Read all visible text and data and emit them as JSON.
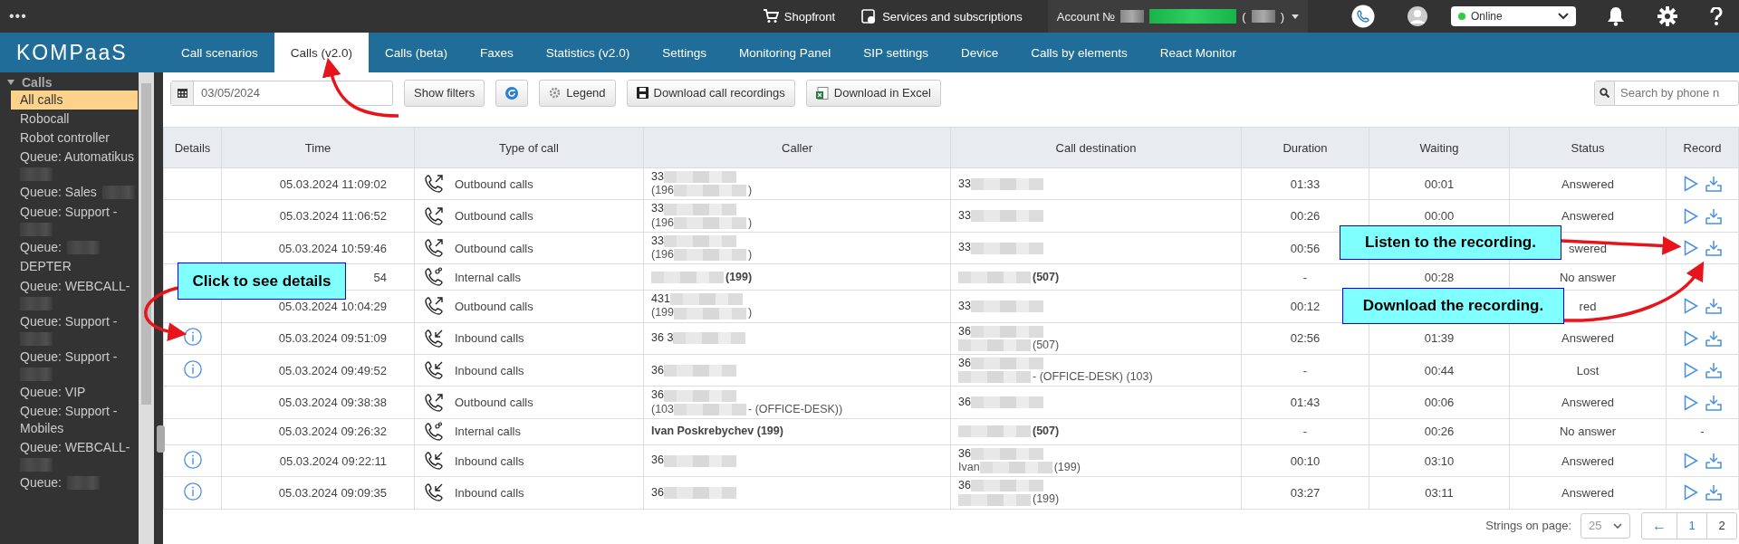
{
  "top_bar": {
    "menu": "•••",
    "links": [
      {
        "kind": "cart",
        "label": "Shopfront"
      },
      {
        "kind": "services",
        "label": "Services and subscriptions"
      }
    ],
    "account": {
      "label": "Account №",
      "open": "(",
      "close": ")"
    },
    "presence": {
      "value": "Online",
      "color": "#2ecc40"
    }
  },
  "nav": {
    "logo": "KOMPaaS",
    "tabs": [
      {
        "label": "Call scenarios",
        "selected": false
      },
      {
        "label": "Calls (v2.0)",
        "selected": true
      },
      {
        "label": "Calls (beta)",
        "selected": false
      },
      {
        "label": "Faxes",
        "selected": false
      },
      {
        "label": "Statistics (v2.0)",
        "selected": false
      },
      {
        "label": "Settings",
        "selected": false
      },
      {
        "label": "Monitoring Panel",
        "selected": false
      },
      {
        "label": "SIP settings",
        "selected": false
      },
      {
        "label": "Device",
        "selected": false
      },
      {
        "label": "Calls by elements",
        "selected": false
      },
      {
        "label": "React Monitor",
        "selected": false
      }
    ]
  },
  "sidebar": {
    "group": {
      "label": "Calls",
      "expanded": true
    },
    "items": [
      {
        "label": "All calls",
        "selected": true
      },
      {
        "label": "Robocall",
        "selected": false
      },
      {
        "label": "Robot controller",
        "selected": false
      },
      {
        "label": "Queue: Automatikus",
        "blur": true,
        "selected": false
      },
      {
        "label": "Queue: Sales",
        "blur": true,
        "selected": false
      },
      {
        "label": "Queue: Support -",
        "blur": true,
        "selected": false
      },
      {
        "label": "Queue:",
        "blur": true,
        "after": "DEPTER",
        "selected": false
      },
      {
        "label": "Queue: WEBCALL-",
        "blur": true,
        "selected": false
      },
      {
        "label": "Queue: Support -",
        "blur": true,
        "selected": false
      },
      {
        "label": "Queue: Support -",
        "blur": true,
        "selected": false
      },
      {
        "label": "Queue: VIP",
        "selected": false
      },
      {
        "label": "Queue: Support - Mobiles",
        "selected": false
      },
      {
        "label": "Queue: WEBCALL-",
        "blur": true,
        "selected": false
      },
      {
        "label": "Queue:",
        "blur": true,
        "selected": false
      }
    ]
  },
  "toolbar": {
    "date": "03/05/2024",
    "buttons": [
      {
        "kind": "text",
        "label": "Show filters"
      },
      {
        "kind": "refresh"
      },
      {
        "kind": "legend",
        "label": "Legend"
      },
      {
        "kind": "save",
        "label": "Download call recordings"
      },
      {
        "kind": "excel",
        "label": "Download in Excel"
      }
    ],
    "search_placeholder": "Search by phone n"
  },
  "table": {
    "columns": [
      "Details",
      "Time",
      "Type of call",
      "Caller",
      "Call destination",
      "Duration",
      "Waiting",
      "Status",
      "Record"
    ],
    "rows": [
      {
        "info": false,
        "time": "05.03.2024 11:09:02",
        "type": {
          "kind": "outbound",
          "label": "Outbound calls"
        },
        "caller": {
          "bold": false,
          "lines": [
            {
              "pre": "33",
              "blur": true
            },
            {
              "pre": "(196",
              "blur": true,
              "post": ")"
            }
          ]
        },
        "destination": {
          "bold": false,
          "lines": [
            {
              "pre": "33",
              "blur": true
            }
          ]
        },
        "duration": "01:33",
        "waiting": "00:01",
        "status": "Answered",
        "record": {
          "kind": "player"
        }
      },
      {
        "info": false,
        "time": "05.03.2024 11:06:52",
        "type": {
          "kind": "outbound",
          "label": "Outbound calls"
        },
        "caller": {
          "bold": false,
          "lines": [
            {
              "pre": "33",
              "blur": true
            },
            {
              "pre": "(196",
              "blur": true,
              "post": ")"
            }
          ]
        },
        "destination": {
          "bold": false,
          "lines": [
            {
              "pre": "33",
              "blur": true
            }
          ]
        },
        "duration": "00:26",
        "waiting": "00:00",
        "status": "Answered",
        "record": {
          "kind": "player"
        }
      },
      {
        "info": false,
        "time": "05.03.2024 10:59:46",
        "type": {
          "kind": "outbound",
          "label": "Outbound calls"
        },
        "caller": {
          "bold": false,
          "lines": [
            {
              "pre": "33",
              "blur": true
            },
            {
              "pre": "(196",
              "blur": true,
              "post": ")"
            }
          ]
        },
        "destination": {
          "bold": false,
          "lines": [
            {
              "pre": "33",
              "blur": true
            }
          ]
        },
        "duration": "00:56",
        "status": "swered",
        "record": {
          "kind": "player"
        }
      },
      {
        "info": false,
        "time": "54",
        "type": {
          "kind": "internal",
          "label": "Internal calls"
        },
        "caller": {
          "bold": true,
          "lines": [
            {
              "blur": true,
              "post": "(199)"
            }
          ]
        },
        "destination": {
          "bold": true,
          "lines": [
            {
              "blur": true,
              "post": "(507)"
            }
          ]
        },
        "duration": "-",
        "waiting": "00:28",
        "status": "No answer"
      },
      {
        "info": false,
        "time": "05.03.2024 10:04:29",
        "type": {
          "kind": "outbound",
          "label": "Outbound calls"
        },
        "caller": {
          "bold": false,
          "lines": [
            {
              "pre": "431",
              "blur": true
            },
            {
              "pre": "(199",
              "blur": true,
              "post": ")"
            }
          ]
        },
        "destination": {
          "bold": false,
          "lines": [
            {
              "pre": "33",
              "blur": true
            }
          ]
        },
        "duration": "00:12",
        "status": "red",
        "record": {
          "kind": "player"
        }
      },
      {
        "info": true,
        "time": "05.03.2024 09:51:09",
        "type": {
          "kind": "inbound",
          "label": "Inbound calls"
        },
        "caller": {
          "bold": false,
          "lines": [
            {
              "pre": "36 3",
              "blur": true
            }
          ]
        },
        "destination": {
          "bold": false,
          "lines": [
            {
              "pre": "36",
              "blur": true
            },
            {
              "blur": true,
              "post": "(507)"
            }
          ]
        },
        "duration": "02:56",
        "waiting": "01:39",
        "status": "Answered",
        "record": {
          "kind": "player"
        }
      },
      {
        "info": true,
        "time": "05.03.2024 09:49:52",
        "type": {
          "kind": "inbound",
          "label": "Inbound calls"
        },
        "caller": {
          "bold": false,
          "lines": [
            {
              "pre": "36",
              "blur": true
            }
          ]
        },
        "destination": {
          "bold": false,
          "lines": [
            {
              "pre": "36",
              "blur": true
            },
            {
              "blur": true,
              "post": "- (OFFICE-DESK) (103)"
            }
          ]
        },
        "duration": "-",
        "waiting": "00:44",
        "status": "Lost",
        "record": {
          "kind": "player"
        }
      },
      {
        "info": false,
        "time": "05.03.2024 09:38:38",
        "type": {
          "kind": "outbound",
          "label": "Outbound calls"
        },
        "caller": {
          "bold": false,
          "lines": [
            {
              "pre": "36",
              "blur": true
            },
            {
              "pre": "(103",
              "blur": true,
              "post": "- (OFFICE-DESK))"
            }
          ]
        },
        "destination": {
          "bold": false,
          "lines": [
            {
              "pre": "36",
              "blur": true
            }
          ]
        },
        "duration": "01:43",
        "waiting": "00:06",
        "status": "Answered",
        "record": {
          "kind": "player"
        }
      },
      {
        "info": false,
        "time": "05.03.2024 09:26:32",
        "type": {
          "kind": "internal",
          "label": "Internal calls"
        },
        "caller": {
          "bold": true,
          "lines": [
            {
              "post": "Ivan Poskrebychev (199)"
            }
          ]
        },
        "destination": {
          "bold": true,
          "lines": [
            {
              "blur": true,
              "post": "(507)"
            }
          ]
        },
        "duration": "-",
        "waiting": "00:26",
        "status": "No answer",
        "record": {
          "kind": "text",
          "text": "-"
        }
      },
      {
        "info": true,
        "time": "05.03.2024 09:22:11",
        "type": {
          "kind": "inbound",
          "label": "Inbound calls"
        },
        "caller": {
          "bold": false,
          "lines": [
            {
              "pre": "36",
              "blur": true
            }
          ]
        },
        "destination": {
          "bold": false,
          "lines": [
            {
              "pre": "36",
              "blur": true
            },
            {
              "pre": "Ivan",
              "blur": true,
              "post": "(199)"
            }
          ]
        },
        "duration": "00:10",
        "waiting": "03:10",
        "status": "Answered",
        "record": {
          "kind": "player"
        }
      },
      {
        "info": true,
        "time": "05.03.2024 09:09:35",
        "type": {
          "kind": "inbound",
          "label": "Inbound calls"
        },
        "caller": {
          "bold": false,
          "lines": [
            {
              "pre": "36",
              "blur": true
            }
          ]
        },
        "destination": {
          "bold": false,
          "lines": [
            {
              "pre": "36",
              "blur": true
            },
            {
              "blur": true,
              "post": "(199)"
            }
          ]
        },
        "duration": "03:27",
        "waiting": "03:11",
        "status": "Answered",
        "record": {
          "kind": "player"
        }
      }
    ]
  },
  "pagination": {
    "label": "Strings on page:",
    "page_size": "25",
    "prev": "←",
    "pages": [
      {
        "label": "1",
        "selected": true
      },
      {
        "label": "2",
        "selected": false
      }
    ]
  },
  "callouts": [
    {
      "text": "Click to see details"
    },
    {
      "text": "Listen to the recording."
    },
    {
      "text": "Download the recording."
    }
  ]
}
